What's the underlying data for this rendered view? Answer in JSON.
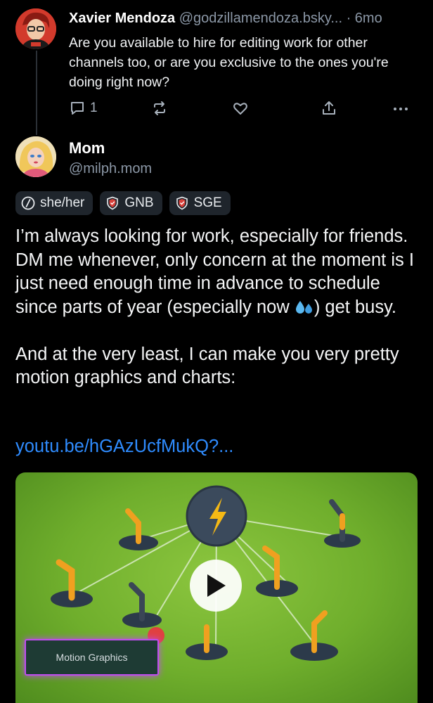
{
  "reply": {
    "author_name": "Xavier Mendoza",
    "author_handle": "@godzillamendoza.bsky...",
    "time": "· 6mo",
    "text": "Are you available to hire for editing work for other channels too, or are you exclusive to the ones you're doing right now?",
    "reply_count": "1",
    "icons": [
      "reply-icon",
      "repost-icon",
      "like-icon",
      "share-icon",
      "more-icon"
    ]
  },
  "post": {
    "author_name": "Mom",
    "author_handle": "@milph.mom",
    "badges": [
      {
        "label": "she/her",
        "icon": "pronoun-icon"
      },
      {
        "label": "GNB",
        "icon": "shield-icon"
      },
      {
        "label": "SGE",
        "icon": "shield-icon"
      }
    ],
    "paragraph1_before_emoji": "I’m always looking for work, especially for friends. DM me whenever, only concern at the moment is I just need enough time in advance to schedule since parts of year (especially now ",
    "paragraph1_after_emoji": ") get busy.",
    "paragraph2": "And at the very least, I can make you very pretty motion graphics and charts:",
    "link": "youtu.be/hGAzUcfMukQ?...",
    "emoji": "sweat-droplets-emoji"
  },
  "video": {
    "overlay_label": "Motion Graphics",
    "play_icon": "play-icon",
    "colors": {
      "background": "#7cbc35",
      "hub": "#3b4a5c",
      "bolt": "#f5b915",
      "label_border": "#c04cf0"
    }
  },
  "colors": {
    "link": "#2f8cff",
    "secondary_text": "#8b97a6",
    "badge_bg": "#1f252c"
  }
}
